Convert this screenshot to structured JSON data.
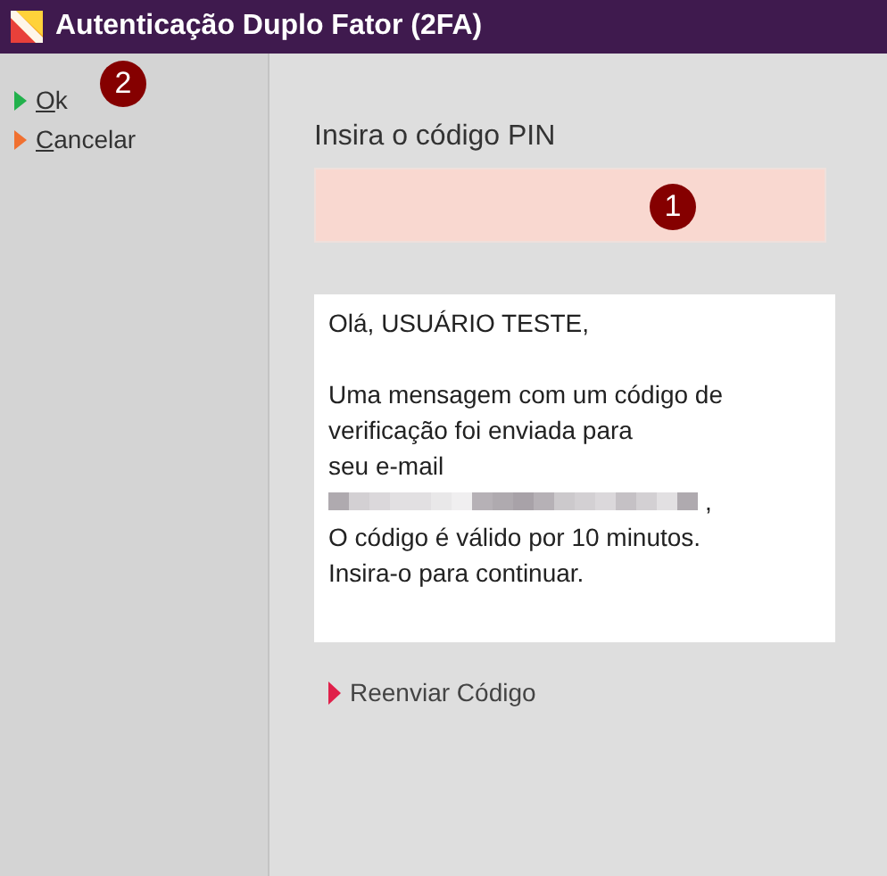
{
  "window": {
    "title": "Autenticação Duplo Fator (2FA)"
  },
  "sidebar": {
    "badge": "2",
    "items": [
      {
        "label": "Ok",
        "color": "#22b14c"
      },
      {
        "label": "Cancelar",
        "color": "#f07030"
      }
    ]
  },
  "pin": {
    "label": "Insira o código PIN",
    "badge": "1"
  },
  "message": {
    "greeting": "Olá, USUÁRIO TESTE,",
    "body_lines": [
      "Uma mensagem com um código de",
      "verificação foi enviada para",
      "seu e-mail"
    ],
    "email_suffix": ",",
    "closing_lines": [
      "O código é válido por 10 minutos.",
      "Insira-o para continuar."
    ]
  },
  "resend_link": {
    "label": "Reenviar Código"
  }
}
